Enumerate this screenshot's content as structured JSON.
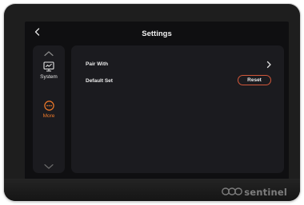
{
  "header": {
    "title": "Settings",
    "back_icon": "chevron-left-icon"
  },
  "sidebar": {
    "up_icon": "chevron-up-icon",
    "down_icon": "chevron-down-icon",
    "items": [
      {
        "label": "System",
        "icon": "monitor-icon",
        "active": false,
        "color": "#e6e6e6"
      },
      {
        "label": "More",
        "icon": "more-icon",
        "active": true,
        "color": "#f07a2a"
      }
    ]
  },
  "main": {
    "rows": [
      {
        "label": "Pair With",
        "action_icon": "chevron-right-icon"
      },
      {
        "label": "Default Set",
        "button_label": "Reset"
      }
    ]
  },
  "device": {
    "brand": "sentinel"
  },
  "colors": {
    "accent": "#f07a2a",
    "reset_border": "#d2573a",
    "screen_bg": "#0f0f11",
    "panel_bg": "#1b1b1f"
  }
}
